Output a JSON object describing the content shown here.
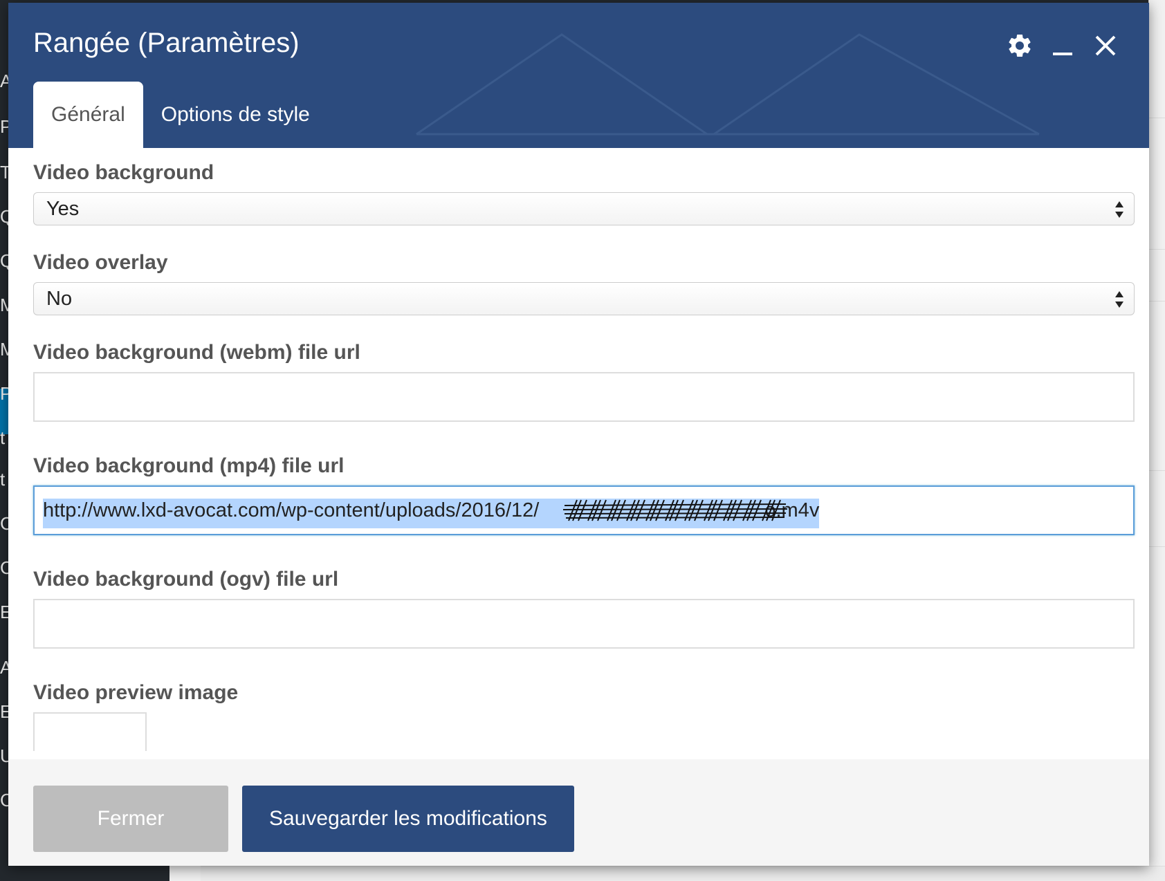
{
  "background": {
    "left_menu_letters": [
      "A",
      "P",
      "T",
      "Q",
      "Q",
      "M",
      "M",
      "P",
      "t",
      "t",
      "C",
      "C",
      "E",
      "A",
      "E",
      "U",
      "C"
    ]
  },
  "modal": {
    "title": "Rangée (Paramètres)",
    "controls": {
      "settings_icon": "gear-icon",
      "minimize_icon": "minimize-icon",
      "close_icon": "close-icon"
    },
    "tabs": [
      {
        "label": "Général",
        "active": true
      },
      {
        "label": "Options de style",
        "active": false
      }
    ],
    "fields": {
      "video_background": {
        "label": "Video background",
        "value": "Yes"
      },
      "video_overlay": {
        "label": "Video overlay",
        "value": "No"
      },
      "webm_url": {
        "label": "Video background (webm) file url",
        "value": ""
      },
      "mp4_url": {
        "label": "Video background (mp4) file url",
        "value_prefix": "http://www.lxd-avocat.com/wp-content/uploads/2016/12/",
        "value_redacted": "##################",
        "value_suffix": "o.m4v"
      },
      "ogv_url": {
        "label": "Video background (ogv) file url",
        "value": ""
      },
      "preview_image": {
        "label": "Video preview image"
      }
    },
    "footer": {
      "close_label": "Fermer",
      "save_label": "Sauvegarder les modifications"
    },
    "colors": {
      "header_bg": "#2c4b7e",
      "save_button": "#2c4b7e",
      "close_button": "#bdbdbd",
      "focus_border": "#5b9dd9",
      "selection": "#b4d5fe"
    }
  }
}
